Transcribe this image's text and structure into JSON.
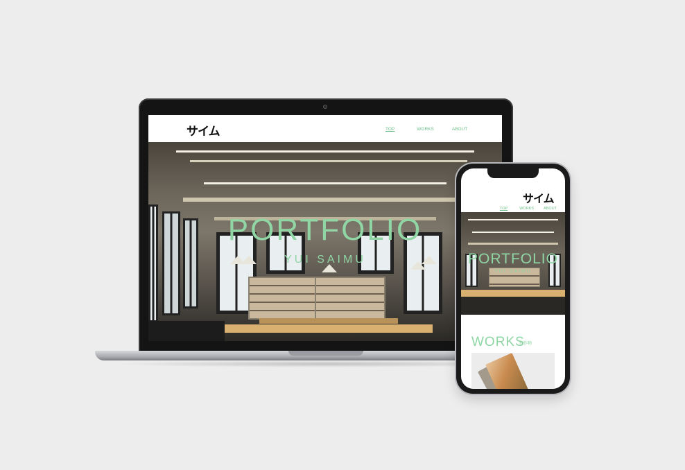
{
  "site": {
    "logo": "サイム",
    "nav": [
      {
        "label": "TOP",
        "active": true
      },
      {
        "label": "WORKS",
        "active": false
      },
      {
        "label": "ABOUT",
        "active": false
      }
    ],
    "hero_title": "PORTFOLIO",
    "hero_subtitle": "YUI SAIMU"
  },
  "phone": {
    "works_title": "WORKS",
    "works_subtitle": "制作物"
  },
  "colors": {
    "accent": "#8fd6a4",
    "nav": "#6fbf8a",
    "background": "#ededed",
    "device": "#141414"
  }
}
